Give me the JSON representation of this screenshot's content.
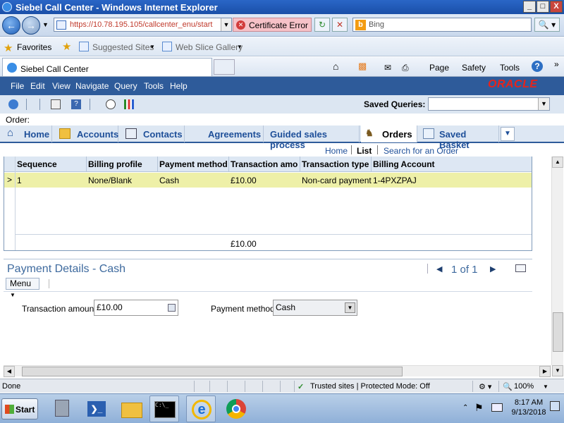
{
  "window": {
    "title": "Siebel Call Center - Windows Internet Explorer",
    "min": "_",
    "max": "□",
    "close": "X"
  },
  "address": {
    "url": "https://10.78.195.105/callcenter_enu/start",
    "cert_error": "Certificate Error",
    "search_placeholder": "Bing",
    "bing_logo": "b",
    "search_icon": "magnifier-icon",
    "chevron": "»"
  },
  "favorites": {
    "label": "Favorites",
    "suggested": "Suggested Sites",
    "webslice": "Web Slice Gallery"
  },
  "ie_tab": {
    "label": "Siebel Call Center"
  },
  "commandbar": {
    "page": "Page",
    "safety": "Safety",
    "tools": "Tools",
    "help": "?"
  },
  "app_menu": [
    "File",
    "Edit",
    "View",
    "Navigate",
    "Query",
    "Tools",
    "Help"
  ],
  "brand": "ORACLE",
  "toolbar": {
    "saved_queries_label": "Saved Queries:",
    "saved_queries_value": ""
  },
  "order_label": "Order:",
  "screen_tabs": [
    {
      "label": "Home",
      "icon": "home-icon"
    },
    {
      "label": "Accounts",
      "icon": "folder-icon"
    },
    {
      "label": "Contacts",
      "icon": "contact-card-icon"
    },
    {
      "label": "Agreements",
      "icon": ""
    },
    {
      "label": "Guided sales process",
      "icon": ""
    },
    {
      "label": "Orders",
      "icon": "cart-icon",
      "active": true
    },
    {
      "label": "Saved Basket",
      "icon": "clipboard-icon"
    }
  ],
  "view_links": {
    "home": "Home",
    "list": "List",
    "search": "Search for an Order"
  },
  "list": {
    "columns": [
      "Sequence",
      "Billing profile",
      "Payment method",
      "Transaction amount",
      "Transaction type",
      "Billing Account"
    ],
    "rows": [
      {
        "sequence": "1",
        "billing_profile": "None/Blank",
        "payment_method": "Cash",
        "transaction_amount": "£10.00",
        "transaction_type": "Non-card payment",
        "billing_account": "1-4PXZPAJ"
      }
    ],
    "total": "£10.00",
    "selected_marker": ">"
  },
  "form": {
    "title": "Payment Details - Cash",
    "pager": "1 of 1",
    "menu_label": "Menu",
    "amount_label": "Transaction amount:",
    "amount_value": "£10.00",
    "method_label": "Payment method:",
    "method_value": "Cash"
  },
  "status": {
    "text": "Done",
    "zone": "Trusted sites | Protected Mode: Off",
    "zoom": "100%"
  },
  "taskbar": {
    "start": "Start",
    "time": "8:17 AM",
    "date": "9/13/2018"
  },
  "colors": {
    "siebel_menu_bg": "#2e5b9a",
    "tab_text": "#1e4f99",
    "selected_row": "#eef0a8",
    "oracle_red": "#e8231a",
    "cert_error_bg": "#f6c2c8"
  }
}
